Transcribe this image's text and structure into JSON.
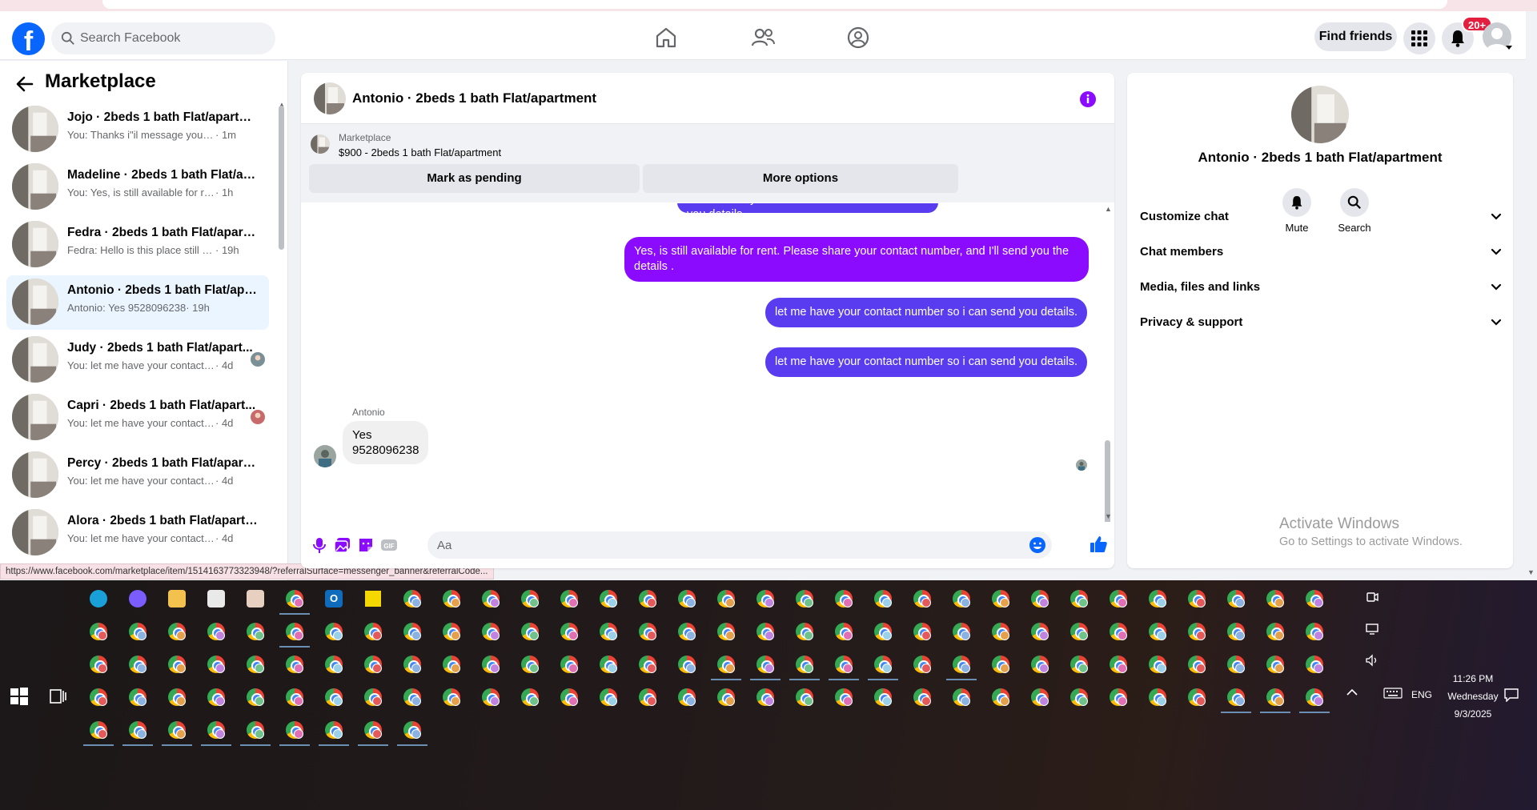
{
  "browser": {
    "status_url": "https://www.facebook.com/marketplace/item/1514163773323948/?referralSurface=messenger_banner&referralCode..."
  },
  "topbar": {
    "logo": "f",
    "search_placeholder": "Search Facebook",
    "find_friends": "Find friends",
    "notifications_badge": "20+",
    "nav_icons": [
      "home-icon",
      "friends-icon",
      "groups-icon"
    ]
  },
  "sidebar": {
    "title": "Marketplace",
    "conversations": [
      {
        "name": "Jojo · 2beds 1 bath Flat/apartment",
        "preview": "You: Thanks i\"il message you in a ...",
        "time": "· 1m",
        "active": false
      },
      {
        "name": "Madeline · 2beds 1 bath Flat/apa...",
        "preview": "You: Yes, is still available for rent. Pl...",
        "time": "· 1h",
        "active": false
      },
      {
        "name": "Fedra · 2beds 1 bath Flat/apartm...",
        "preview": "Fedra: Hello is this place still avail...",
        "time": "· 19h",
        "active": false
      },
      {
        "name": "Antonio · 2beds 1 bath Flat/apar...",
        "preview": "Antonio: Yes 9528096238",
        "time": "· 19h",
        "active": true
      },
      {
        "name": "Judy · 2beds 1 bath Flat/apart...",
        "preview": "You: let me have your contact n...",
        "time": "· 4d",
        "active": false
      },
      {
        "name": "Capri · 2beds 1 bath Flat/apart...",
        "preview": "You: let me have your contact n...",
        "time": "· 4d",
        "active": false
      },
      {
        "name": "Percy · 2beds 1 bath Flat/apartm...",
        "preview": "You: let me have your contact num...",
        "time": "· 4d",
        "active": false
      },
      {
        "name": "Alora · 2beds 1 bath Flat/apartm...",
        "preview": "You: let me have your contact num...",
        "time": "· 4d",
        "active": false
      }
    ]
  },
  "chat": {
    "title": "Antonio · 2beds 1 bath Flat/apartment",
    "banner_label": "Marketplace",
    "banner_title": "$900 - 2beds 1 bath Flat/apartment",
    "mark_pending": "Mark as pending",
    "more_options": "More options",
    "partial_message": "let me have your contact number so i can send you details.",
    "outgoing": [
      "Yes, is still available for rent. Please share your contact number, and I'll send you the details .",
      "let me have your contact number so i can send you details.",
      "let me have your contact number so i can send you details."
    ],
    "incoming_sender": "Antonio",
    "incoming_line1": "Yes",
    "incoming_line2": "9528096238",
    "composer_placeholder": "Aa"
  },
  "info_panel": {
    "name": "Antonio · 2beds 1 bath Flat/apartment",
    "mute": "Mute",
    "search": "Search",
    "rows": [
      "Customize chat",
      "Chat members",
      "Media, files and links",
      "Privacy & support"
    ]
  },
  "watermark": {
    "line1": "Activate Windows",
    "line2": "Go to Settings to activate Windows."
  },
  "taskbar": {
    "language": "ENG",
    "time": "11:26 PM",
    "day": "Wednesday",
    "date": "9/3/2025"
  },
  "colors": {
    "facebook_blue": "#0866ff",
    "bubble_purple": "#8a0bff",
    "bubble_indigo": "#5a3cf0",
    "active_conversation": "#ebf5ff",
    "notification_red": "#e41e3f"
  }
}
